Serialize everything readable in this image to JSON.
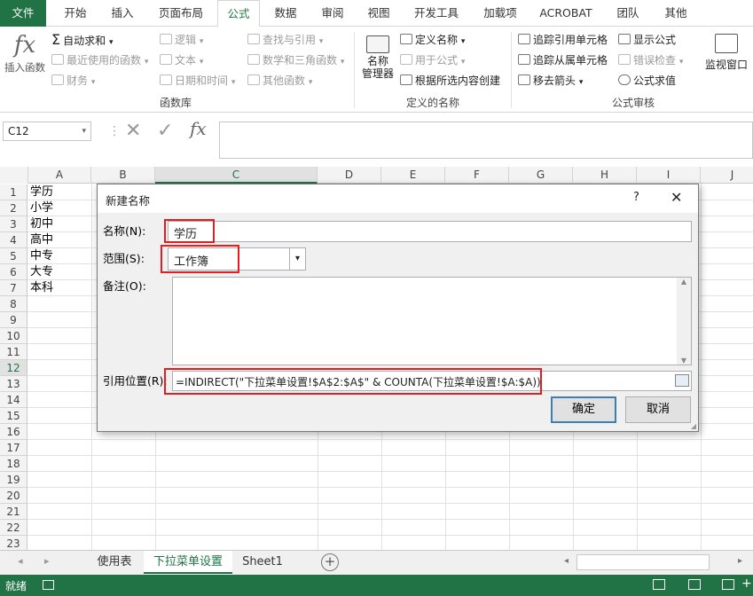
{
  "ribbon_tabs": [
    "文件",
    "开始",
    "插入",
    "页面布局",
    "公式",
    "数据",
    "审阅",
    "视图",
    "开发工具",
    "加载项",
    "ACROBAT",
    "团队",
    "其他"
  ],
  "ribbon": {
    "insert_function_label": "插入函数",
    "fx_symbol": "fx",
    "function_library": {
      "autosum": "自动求和",
      "recent": "最近使用的函数",
      "financial": "财务",
      "logical": "逻辑",
      "text": "文本",
      "datetime": "日期和时间",
      "lookup": "查找与引用",
      "math": "数学和三角函数",
      "more": "其他函数",
      "group_label": "函数库"
    },
    "defined_names": {
      "name_manager_l1": "名称",
      "name_manager_l2": "管理器",
      "define_name": "定义名称",
      "use_in_formula": "用于公式",
      "create_from_selection": "根据所选内容创建",
      "group_label": "定义的名称"
    },
    "formula_auditing": {
      "trace_precedents": "追踪引用单元格",
      "trace_dependents": "追踪从属单元格",
      "remove_arrows": "移去箭头",
      "show_formulas": "显示公式",
      "error_checking": "错误检查",
      "evaluate_formula": "公式求值",
      "group_label": "公式审核"
    },
    "watch_window": "监视窗口"
  },
  "formula_bar": {
    "name_box": "C12",
    "cancel": "✕",
    "enter": "✓",
    "fx": "fx"
  },
  "grid": {
    "columns": [
      "A",
      "B",
      "C",
      "D",
      "E",
      "F",
      "G",
      "H",
      "I",
      "J"
    ],
    "rows": [
      "1",
      "2",
      "3",
      "4",
      "5",
      "6",
      "7",
      "8",
      "9",
      "10",
      "11",
      "12",
      "13",
      "14",
      "15",
      "16",
      "17",
      "18",
      "19",
      "20",
      "21",
      "22",
      "23"
    ],
    "col_a_values": [
      "学历",
      "小学",
      "初中",
      "高中",
      "中专",
      "大专",
      "本科"
    ]
  },
  "dialog": {
    "title": "新建名称",
    "help": "?",
    "close": "✕",
    "name_label": "名称(N):",
    "name_value": "学历",
    "scope_label": "范围(S):",
    "scope_value": "工作簿",
    "comment_label": "备注(O):",
    "refers_label": "引用位置(R):",
    "refers_value": "=INDIRECT(\"下拉菜单设置!$A$2:$A$\" & COUNTA(下拉菜单设置!$A:$A))",
    "ok": "确定",
    "cancel": "取消"
  },
  "sheet_tabs": [
    "使用表",
    "下拉菜单设置",
    "Sheet1"
  ],
  "active_sheet": "下拉菜单设置",
  "status": {
    "ready": "就绪",
    "zoom": "+"
  },
  "colors": {
    "accent": "#217346",
    "highlight": "#e02020"
  }
}
